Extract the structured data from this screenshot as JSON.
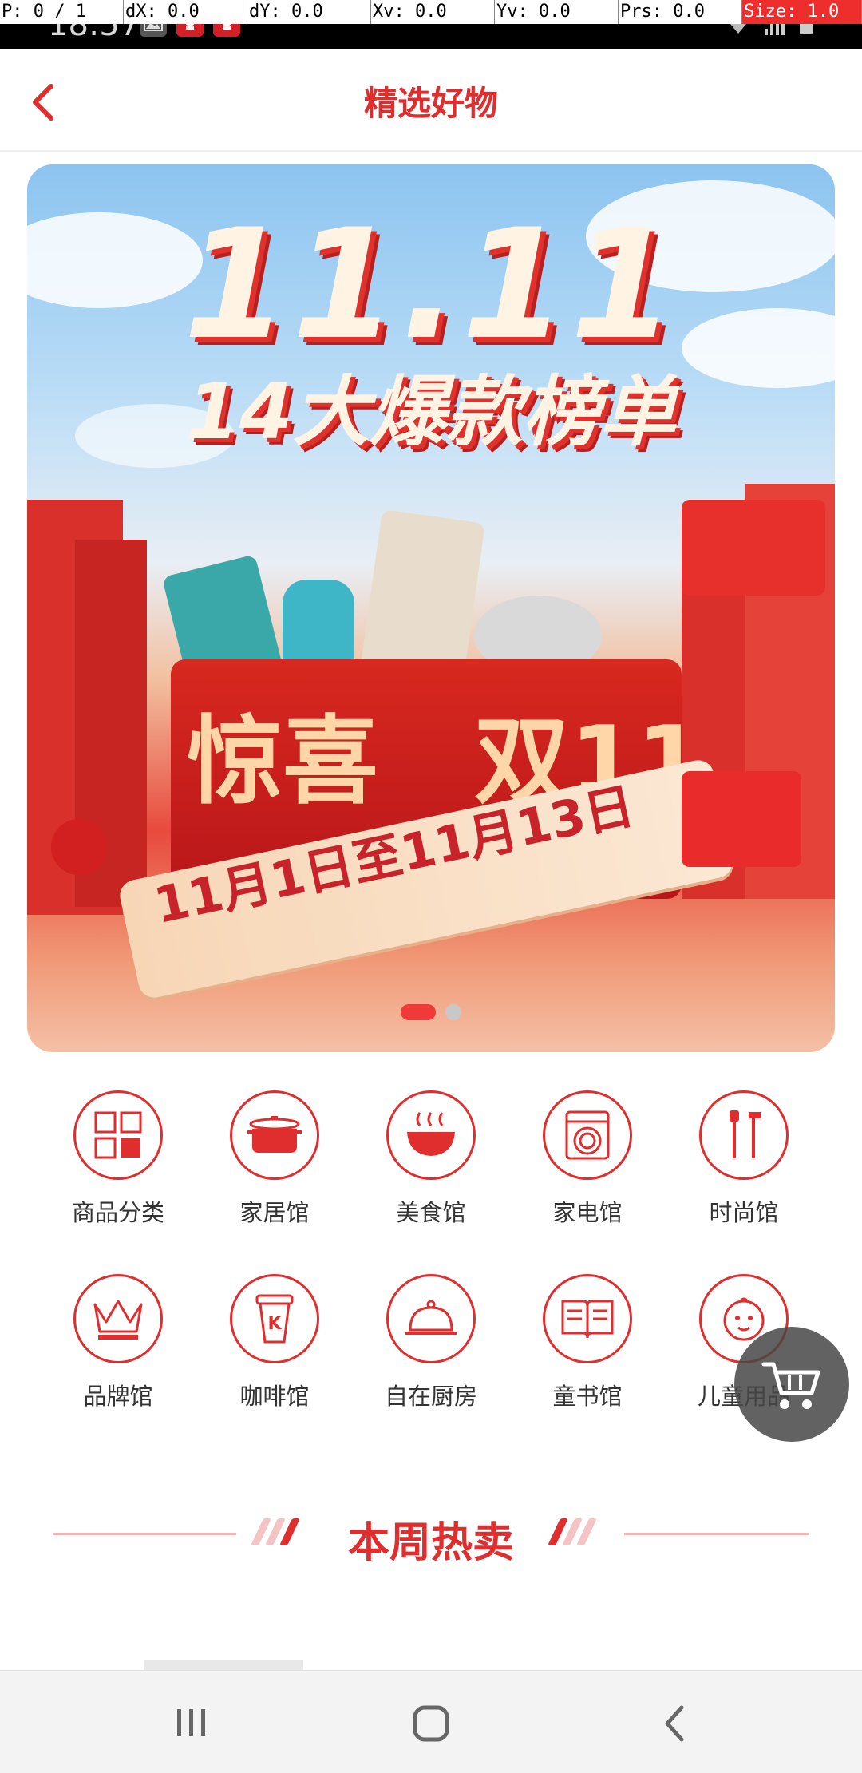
{
  "debug": {
    "cells": [
      "P: 0 / 1",
      "dX: 0.0",
      "dY: 0.0",
      "Xv: 0.0",
      "Yv: 0.0",
      "Prs: 0.0",
      "Size: 1.0"
    ]
  },
  "statusbar": {
    "time": "18:57"
  },
  "header": {
    "title": "精选好物"
  },
  "banner": {
    "headline": "11.11",
    "subtitle": "14大爆款榜单",
    "box_left": "惊喜",
    "box_right": "双11",
    "date_ribbon": "11月1日至11月13日",
    "pages": 2,
    "active_page": 1
  },
  "categories": [
    {
      "label": "商品分类",
      "icon": "grid-icon"
    },
    {
      "label": "家居馆",
      "icon": "pot-icon"
    },
    {
      "label": "美食馆",
      "icon": "bowl-icon"
    },
    {
      "label": "家电馆",
      "icon": "washing-machine-icon"
    },
    {
      "label": "时尚馆",
      "icon": "tools-icon"
    },
    {
      "label": "品牌馆",
      "icon": "crown-icon"
    },
    {
      "label": "咖啡馆",
      "icon": "coffee-cup-icon"
    },
    {
      "label": "自在厨房",
      "icon": "cloche-icon"
    },
    {
      "label": "童书馆",
      "icon": "book-icon"
    },
    {
      "label": "儿童用品",
      "icon": "baby-icon"
    }
  ],
  "section": {
    "title": "本周热卖"
  },
  "colors": {
    "accent": "#e02d2d",
    "label": "#333333",
    "nav_bg": "#f3f3f3"
  }
}
